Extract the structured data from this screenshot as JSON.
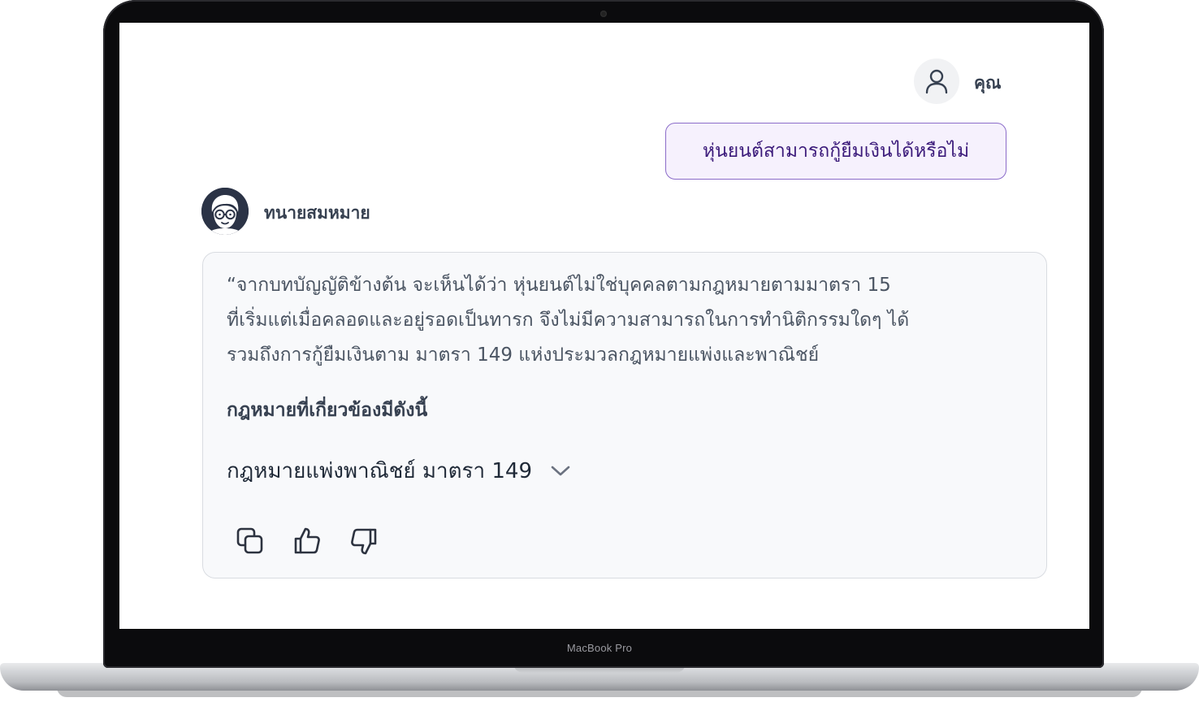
{
  "device": {
    "model_label": "MacBook Pro"
  },
  "chat": {
    "user": {
      "name": "คุณ",
      "avatar_icon": "user-icon",
      "message": "หุ่นยนต์สามารถกู้ยืมเงินได้หรือไม่"
    },
    "bot": {
      "name": "ทนายสมหมาย",
      "avatar_icon": "lawyer-avatar",
      "answer_lines": [
        "“จากบทบัญญัติข้างต้น จะเห็นได้ว่า หุ่นยนต์ไม่ใช่บุคคลตามกฎหมายตามมาตรา 15",
        "ที่เริ่มแต่เมื่อคลอดและอยู่รอดเป็นทารก จึงไม่มีความสามารถในการทำนิติกรรมใดๆ ได้",
        "รวมถึงการกู้ยืมเงินตาม มาตรา 149 แห่งประมวลกฎหมายแพ่งและพาณิชย์"
      ],
      "related_law_heading": "กฎหมายที่เกี่ยวข้องมีดังนี้",
      "related_law_item": "กฎหมายแพ่งพาณิชย์ มาตรา 149",
      "actions": [
        "copy-icon",
        "thumbs-up-icon",
        "thumbs-down-icon"
      ]
    }
  },
  "colors": {
    "user_bubble_border": "#8b6cc9",
    "user_bubble_bg": "#f6f1fd",
    "user_bubble_text": "#3b1a7a",
    "bot_avatar_bg": "#2b3346",
    "card_bg": "#f8f9fb",
    "card_border": "#d9dce1"
  }
}
